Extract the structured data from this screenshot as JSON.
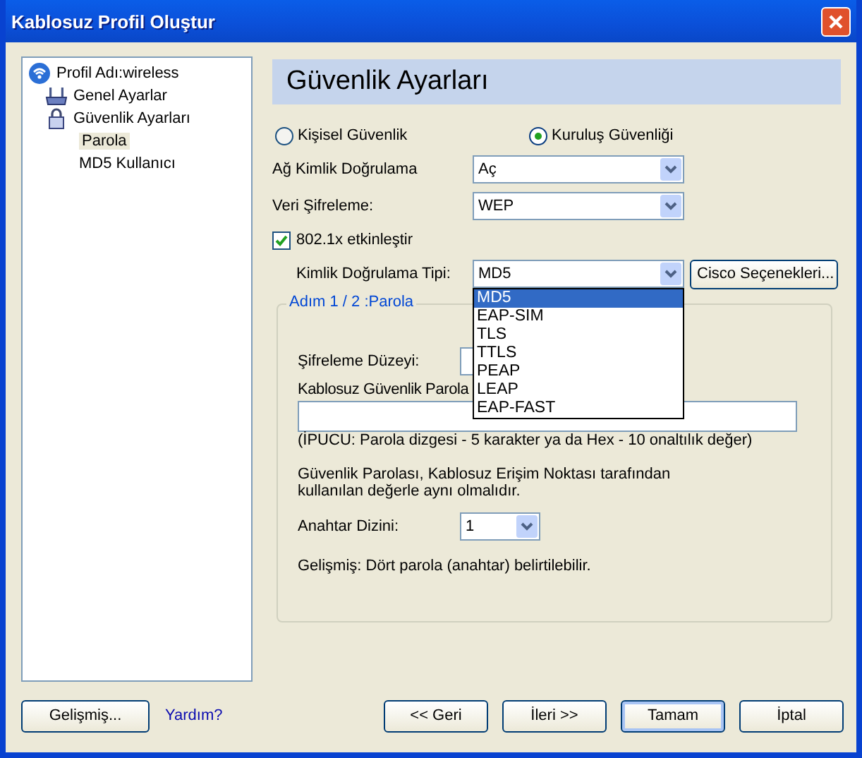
{
  "window": {
    "title": "Kablosuz Profil Oluştur"
  },
  "tree": {
    "label": "Profil Adı:wireless",
    "children": [
      {
        "label": "Genel Ayarlar",
        "kind": "router",
        "selected": false
      },
      {
        "label": "Güvenlik Ayarları",
        "kind": "lock",
        "selected": false,
        "children": [
          {
            "label": "Parola",
            "selected": true
          },
          {
            "label": "MD5 Kullanıcı",
            "selected": false
          }
        ]
      }
    ]
  },
  "panel_title": "Güvenlik Ayarları",
  "security_mode": [
    {
      "label": "Kişisel Güvenlik",
      "selected": false
    },
    {
      "label": "Kuruluş Güvenliği",
      "selected": true
    }
  ],
  "network_auth": {
    "label": "Ağ Kimlik Doğrulama",
    "value": "Aç"
  },
  "data_encryption": {
    "label": "Veri Şifreleme:",
    "value": "WEP"
  },
  "enable_8021x": {
    "label": "802.1x etkinleştir",
    "checked": true
  },
  "auth_type": {
    "label": "Kimlik Doğrulama Tipi:",
    "value": "MD5",
    "expanded": true,
    "options": [
      {
        "label": "MD5",
        "selected": true
      },
      {
        "label": "EAP-SIM",
        "selected": false
      },
      {
        "label": "TLS",
        "selected": false
      },
      {
        "label": "TTLS",
        "selected": false
      },
      {
        "label": "PEAP",
        "selected": false
      },
      {
        "label": "LEAP",
        "selected": false
      },
      {
        "label": "EAP-FAST",
        "selected": false
      }
    ]
  },
  "cisco_button": "Cisco Seçenekleri...",
  "group": {
    "title": "Adım 1 / 2 :Parola",
    "encryption_level": {
      "label": "Şifreleme Düzeyi:"
    },
    "passphrase": {
      "label": "Kablosuz Güvenlik Parola"
    },
    "hint": "(İPUCU: Parola dizgesi - 5 karakter ya da Hex - 10 onaltılık değer)",
    "note": "Güvenlik Parolası, Kablosuz Erişim Noktası tarafından kullanılan değerle aynı olmalıdır.",
    "key_index": {
      "label": "Anahtar Dizini:",
      "value": "1"
    },
    "advanced_note": "Gelişmiş: Dört parola (anahtar) belirtilebilir."
  },
  "footer": {
    "advanced_button": "Gelişmiş...",
    "help_link": "Yardım?",
    "buttons": [
      {
        "label": "<< Geri",
        "default": false
      },
      {
        "label": "İleri >>",
        "default": false
      },
      {
        "label": "Tamam",
        "default": true
      },
      {
        "label": "İptal",
        "default": false
      }
    ]
  }
}
